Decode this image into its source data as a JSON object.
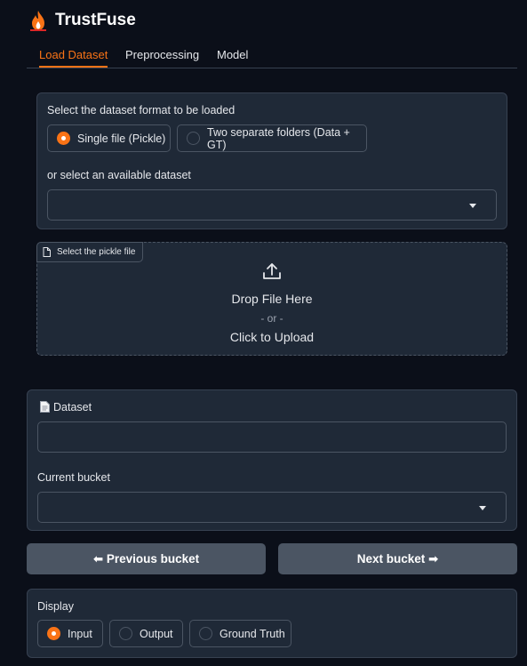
{
  "app": {
    "title": "TrustFuse",
    "logo_icon": "flame-icon"
  },
  "tabs": [
    {
      "label": "Load Dataset",
      "active": true
    },
    {
      "label": "Preprocessing",
      "active": false
    },
    {
      "label": "Model",
      "active": false
    }
  ],
  "load": {
    "format_label": "Select the dataset format to be loaded",
    "format_options": [
      {
        "label": "Single file (Pickle)",
        "selected": true
      },
      {
        "label": "Two separate folders (Data + GT)",
        "selected": false
      }
    ],
    "available_label": "or select an available dataset",
    "available_value": ""
  },
  "upload": {
    "tag_label": "Select the pickle file",
    "drop_text": "Drop File Here",
    "or_text": "- or -",
    "click_text": "Click to Upload"
  },
  "dataset": {
    "label": "Dataset",
    "value": "",
    "bucket_label": "Current bucket",
    "bucket_value": ""
  },
  "buttons": {
    "prev": "⬅ Previous bucket",
    "next": "Next bucket ➡"
  },
  "display": {
    "label": "Display",
    "options": [
      {
        "label": "Input",
        "selected": true
      },
      {
        "label": "Output",
        "selected": false
      },
      {
        "label": "Ground Truth",
        "selected": false
      }
    ]
  },
  "colors": {
    "accent": "#f97316",
    "background": "#0b0f19",
    "panel": "#1f2937",
    "button": "#4b5563"
  }
}
